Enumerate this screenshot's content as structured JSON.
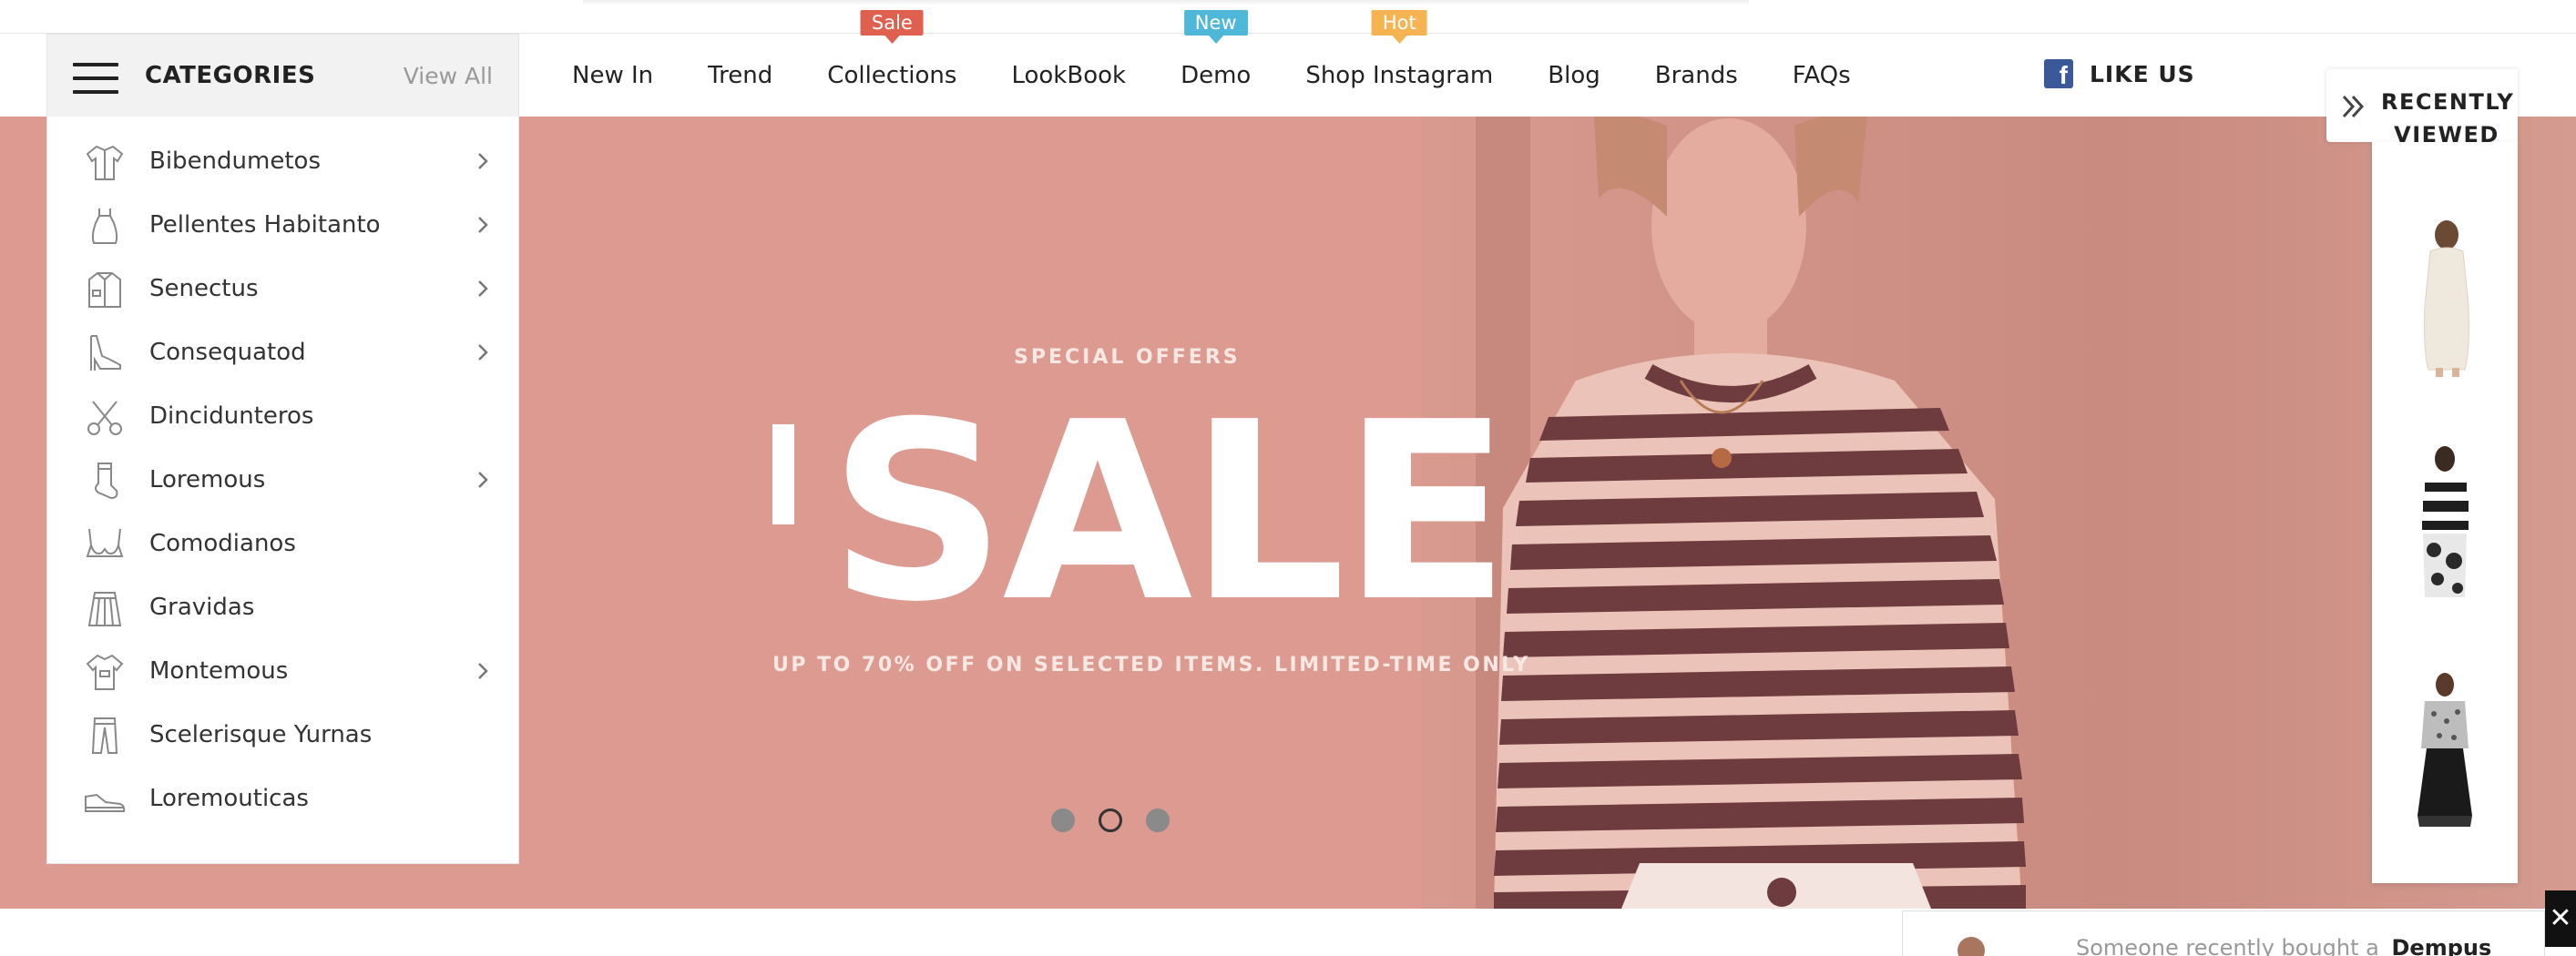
{
  "header": {
    "categories_title": "CATEGORIES",
    "view_all": "View All",
    "menu": [
      {
        "label": "New In",
        "badge": "",
        "badge_color": ""
      },
      {
        "label": "Trend",
        "badge": "",
        "badge_color": ""
      },
      {
        "label": "Collections",
        "badge": "Sale",
        "badge_color": "#e0604f"
      },
      {
        "label": "LookBook",
        "badge": "",
        "badge_color": ""
      },
      {
        "label": "Demo",
        "badge": "New",
        "badge_color": "#4fb8d8"
      },
      {
        "label": "Shop Instagram",
        "badge": "Hot",
        "badge_color": "#f5b451"
      },
      {
        "label": "Blog",
        "badge": "",
        "badge_color": ""
      },
      {
        "label": "Brands",
        "badge": "",
        "badge_color": ""
      },
      {
        "label": "FAQs",
        "badge": "",
        "badge_color": ""
      }
    ],
    "like_us": "LIKE US",
    "facebook_glyph": "f"
  },
  "categories": [
    {
      "label": "Bibendumetos",
      "icon": "shirt-icon",
      "has_sub": true
    },
    {
      "label": "Pellentes Habitanto",
      "icon": "dress-icon",
      "has_sub": true
    },
    {
      "label": "Senectus",
      "icon": "jacket-icon",
      "has_sub": true
    },
    {
      "label": "Consequatod",
      "icon": "heel-shoe-icon",
      "has_sub": true
    },
    {
      "label": "Dincidunteros",
      "icon": "scissors-icon",
      "has_sub": false
    },
    {
      "label": "Loremous",
      "icon": "sock-icon",
      "has_sub": true
    },
    {
      "label": "Comodianos",
      "icon": "bra-icon",
      "has_sub": false
    },
    {
      "label": "Gravidas",
      "icon": "skirt-icon",
      "has_sub": false
    },
    {
      "label": "Montemous",
      "icon": "t-shirt-icon",
      "has_sub": true
    },
    {
      "label": "Scelerisque Yurnas",
      "icon": "pants-icon",
      "has_sub": false
    },
    {
      "label": "Loremouticas",
      "icon": "sneaker-icon",
      "has_sub": false
    }
  ],
  "hero": {
    "special": "SPECIAL OFFERS",
    "headline": "SALE",
    "subline": "UP TO 70% OFF ON SELECTED ITEMS. LIMITED-TIME ONLY",
    "slides": 3,
    "active_slide": 2,
    "bg_color": "#dc9a90"
  },
  "recently_viewed": {
    "title_line1": "RECENTLY",
    "title_line2": "VIEWED",
    "items": [
      "white-dress-thumb",
      "striped-top-thumb",
      "black-skirt-outfit-thumb"
    ]
  },
  "toast": {
    "text": "Someone recently bought a",
    "product": "Dempus"
  },
  "close_glyph": "✕"
}
